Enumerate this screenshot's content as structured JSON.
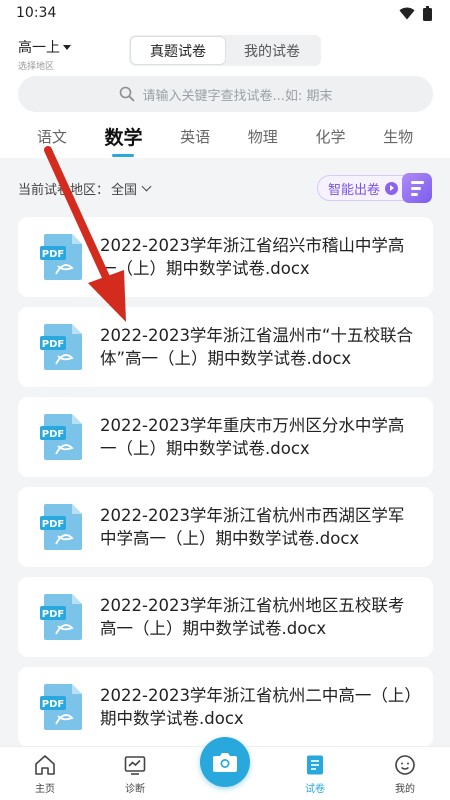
{
  "status": {
    "time": "10:34"
  },
  "header": {
    "grade": "高一上",
    "grade_sub": "选择地区",
    "segments": [
      {
        "label": "真题试卷",
        "active": true
      },
      {
        "label": "我的试卷",
        "active": false
      }
    ],
    "search_placeholder": "请输入关键字查找试卷...如: 期末"
  },
  "subjects": [
    {
      "label": "语文",
      "active": false
    },
    {
      "label": "数学",
      "active": true
    },
    {
      "label": "英语",
      "active": false
    },
    {
      "label": "物理",
      "active": false
    },
    {
      "label": "化学",
      "active": false
    },
    {
      "label": "生物",
      "active": false
    }
  ],
  "filter": {
    "label": "当前试卷地区：",
    "value": "全国"
  },
  "smart_button": {
    "label": "智能出卷"
  },
  "papers": [
    {
      "title": "2022-2023学年浙江省绍兴市稽山中学高一（上）期中数学试卷.docx"
    },
    {
      "title": "2022-2023学年浙江省温州市“十五校联合体”高一（上）期中数学试卷.docx"
    },
    {
      "title": "2022-2023学年重庆市万州区分水中学高一（上）期中数学试卷.docx"
    },
    {
      "title": "2022-2023学年浙江省杭州市西湖区学军中学高一（上）期中数学试卷.docx"
    },
    {
      "title": "2022-2023学年浙江省杭州地区五校联考高一（上）期中数学试卷.docx"
    },
    {
      "title": "2022-2023学年浙江省杭州二中高一（上）期中数学试卷.docx"
    }
  ],
  "tabs": [
    {
      "label": "主页",
      "icon": "home-icon",
      "active": false
    },
    {
      "label": "诊断",
      "icon": "diagnosis-icon",
      "active": false
    },
    {
      "label": "试卷",
      "icon": "paper-icon",
      "active": true
    },
    {
      "label": "我的",
      "icon": "profile-icon",
      "active": false
    }
  ],
  "colors": {
    "accent": "#29a8dd",
    "purple": "#7a55e6",
    "arrow": "#d42b1f"
  }
}
